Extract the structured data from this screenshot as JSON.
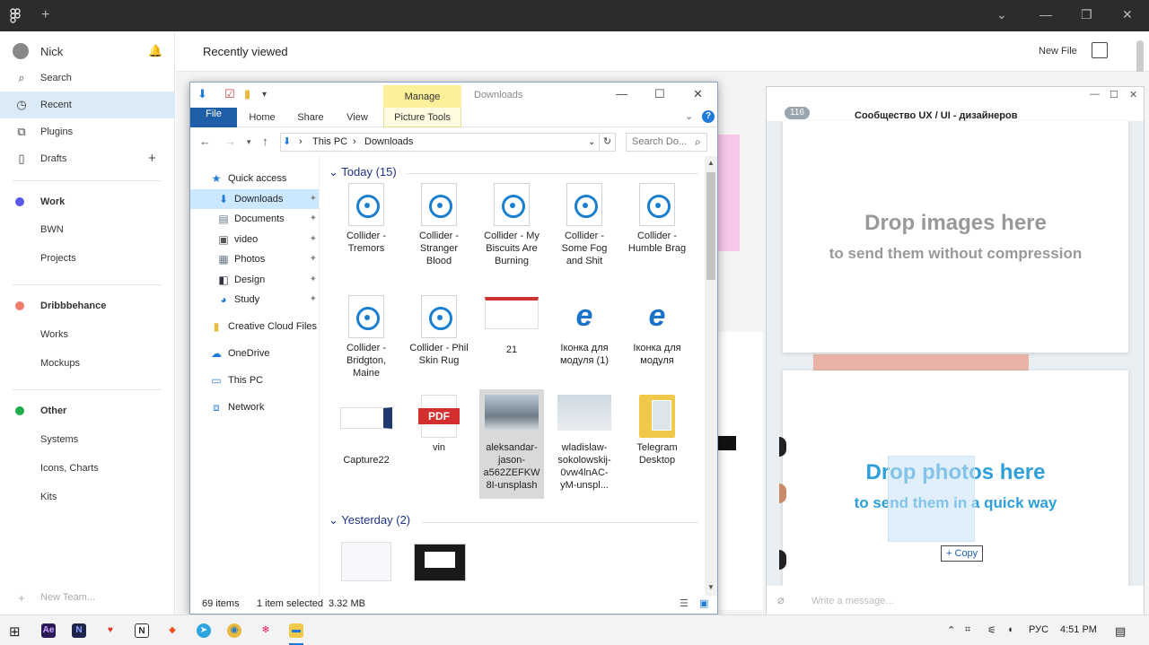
{
  "figma": {
    "user": "Nick",
    "sidebar": {
      "top_items": [
        {
          "label": "Search",
          "icon": "search-icon"
        },
        {
          "label": "Recent",
          "icon": "clock-icon"
        },
        {
          "label": "Plugins",
          "icon": "plugin-icon"
        },
        {
          "label": "Drafts",
          "icon": "file-icon"
        }
      ],
      "teams": [
        {
          "name": "Work",
          "color": "#5a57e8",
          "projects": [
            "BWN",
            "Projects"
          ]
        },
        {
          "name": "Dribbbehance",
          "color": "#f07c6c",
          "projects": [
            "Works",
            "Mockups"
          ]
        },
        {
          "name": "Other",
          "color": "#1fad4a",
          "projects": [
            "Systems",
            "Icons, Charts",
            "Kits"
          ]
        }
      ],
      "new_team": "New Team..."
    },
    "header": {
      "title": "Recently viewed",
      "new_file": "New File"
    }
  },
  "explorer": {
    "manage_tab": "Manage",
    "title": "Downloads",
    "ribbon_tabs": [
      "File",
      "Home",
      "Share",
      "View"
    ],
    "picture_tools": "Picture Tools",
    "path": [
      "This PC",
      "Downloads"
    ],
    "search_placeholder": "Search Do...",
    "nav": {
      "quick_access": "Quick access",
      "pinned": [
        "Downloads",
        "Documents",
        "video",
        "Photos",
        "Design",
        "Study"
      ],
      "other": [
        "Creative Cloud Files",
        "OneDrive",
        "This PC",
        "Network"
      ]
    },
    "groups": [
      {
        "label": "Today (15)",
        "files": [
          {
            "name": "Collider - Tremors",
            "kind": "collider"
          },
          {
            "name": "Collider - Stranger Blood",
            "kind": "collider"
          },
          {
            "name": "Collider - My Biscuits Are Burning",
            "kind": "collider"
          },
          {
            "name": "Collider - Some Fog and Shit",
            "kind": "collider"
          },
          {
            "name": "Collider - Humble Brag",
            "kind": "collider"
          },
          {
            "name": "Collider - Bridgton, Maine",
            "kind": "collider"
          },
          {
            "name": "Collider - Phil Skin Rug",
            "kind": "collider"
          },
          {
            "name": "21",
            "kind": "doc"
          },
          {
            "name": "Іконка для модуля (1)",
            "kind": "ie"
          },
          {
            "name": "Іконка для модуля",
            "kind": "ie"
          },
          {
            "name": "Capture22",
            "kind": "capture"
          },
          {
            "name": "vin",
            "kind": "pdf"
          },
          {
            "name": "aleksandar-jason-a562ZEFKW8I-unsplash",
            "kind": "photo",
            "selected": true
          },
          {
            "name": "wladislaw-sokolowskij-0vw4lnAC-yM-unspl...",
            "kind": "photo2"
          },
          {
            "name": "Telegram Desktop",
            "kind": "folder"
          }
        ]
      },
      {
        "label": "Yesterday (2)",
        "files": []
      }
    ],
    "pdf_label": "PDF",
    "status": {
      "items": "69 items",
      "selected": "1 item selected",
      "size": "3.32 MB"
    }
  },
  "telegram": {
    "header_count": "116",
    "header_text": "Сообщество UX / UI - дизайнеров",
    "drop1": {
      "title": "Drop images here",
      "subtitle": "to send them without compression"
    },
    "drop2": {
      "title": "Drop photos here",
      "subtitle": "to send them in a quick way"
    },
    "copy_label": "Copy",
    "input_placeholder": "Write a message..."
  },
  "taskbar": {
    "lang": "РУС",
    "time": "4:51 PM"
  },
  "colors": {
    "figma_bar": "#2c2c2c",
    "active": "#daebf7",
    "manage": "#fcf09a",
    "file_tab": "#1f5fa8",
    "tg_blue": "#2d9fd9"
  }
}
